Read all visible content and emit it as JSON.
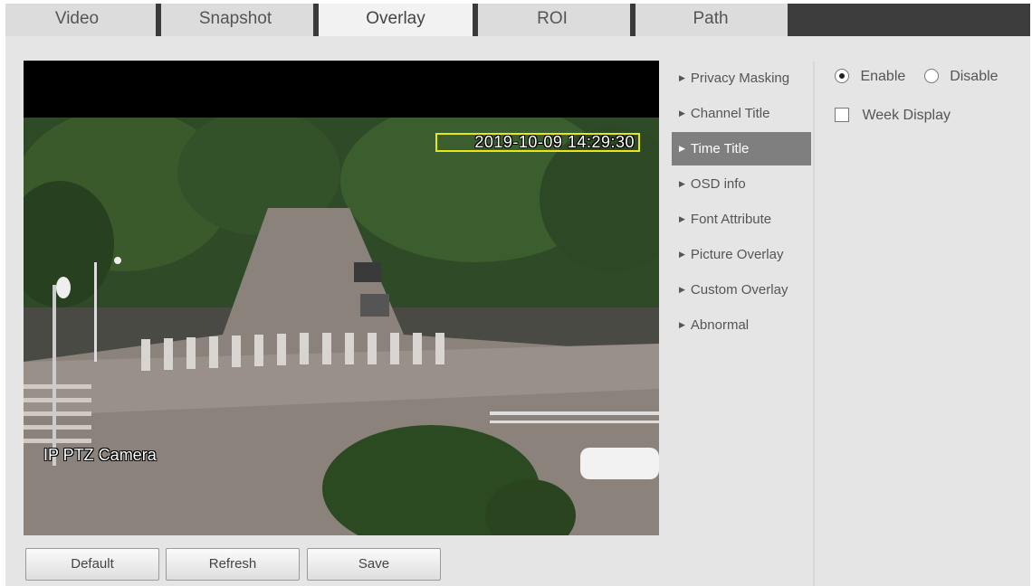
{
  "tabs": [
    {
      "label": "Video",
      "active": false
    },
    {
      "label": "Snapshot",
      "active": false
    },
    {
      "label": "Overlay",
      "active": true
    },
    {
      "label": "ROI",
      "active": false
    },
    {
      "label": "Path",
      "active": false
    }
  ],
  "video": {
    "time_osd": "2019-10-09 14:29:30",
    "channel_osd": "IP PTZ Camera"
  },
  "buttons": {
    "default": "Default",
    "refresh": "Refresh",
    "save": "Save"
  },
  "menu": [
    {
      "label": "Privacy Masking",
      "active": false
    },
    {
      "label": "Channel Title",
      "active": false
    },
    {
      "label": "Time Title",
      "active": true
    },
    {
      "label": "OSD info",
      "active": false
    },
    {
      "label": "Font Attribute",
      "active": false
    },
    {
      "label": "Picture Overlay",
      "active": false
    },
    {
      "label": "Custom Overlay",
      "active": false
    },
    {
      "label": "Abnormal",
      "active": false
    }
  ],
  "options": {
    "enable_label": "Enable",
    "disable_label": "Disable",
    "selected": "Enable",
    "week_display_label": "Week Display",
    "week_display_checked": false
  }
}
